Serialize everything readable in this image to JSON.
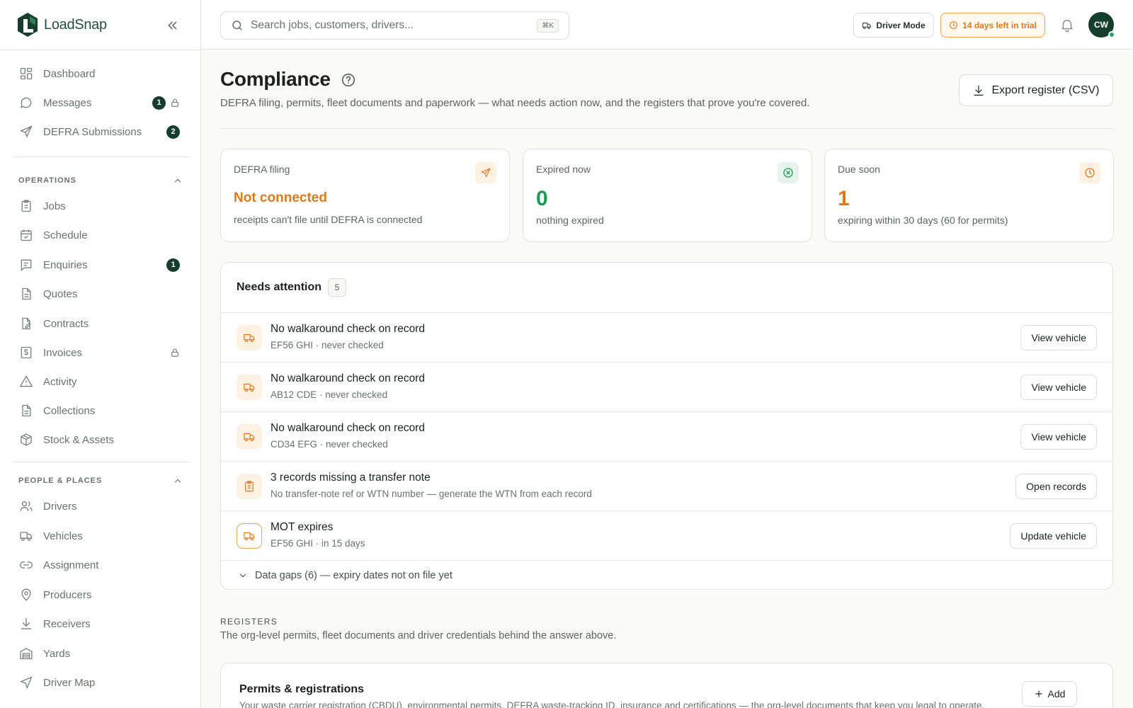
{
  "app": {
    "name": "LoadSnap",
    "brand_color": "#163e2c"
  },
  "sidebar": {
    "top_items": [
      {
        "label": "Dashboard",
        "icon": "dashboard-icon"
      },
      {
        "label": "Messages",
        "icon": "message-icon",
        "badge": "1",
        "locked": true
      },
      {
        "label": "DEFRA Submissions",
        "icon": "send-icon",
        "badge": "2"
      }
    ],
    "sections": [
      {
        "title": "OPERATIONS",
        "items": [
          {
            "label": "Jobs",
            "icon": "clipboard-icon"
          },
          {
            "label": "Schedule",
            "icon": "calendar-icon"
          },
          {
            "label": "Enquiries",
            "icon": "enquiry-icon",
            "badge": "1"
          },
          {
            "label": "Quotes",
            "icon": "document-icon"
          },
          {
            "label": "Contracts",
            "icon": "contract-icon"
          },
          {
            "label": "Invoices",
            "icon": "invoice-icon",
            "locked": true
          },
          {
            "label": "Activity",
            "icon": "warning-icon"
          },
          {
            "label": "Collections",
            "icon": "document-icon"
          },
          {
            "label": "Stock & Assets",
            "icon": "box-icon"
          }
        ]
      },
      {
        "title": "PEOPLE & PLACES",
        "items": [
          {
            "label": "Drivers",
            "icon": "users-icon"
          },
          {
            "label": "Vehicles",
            "icon": "truck-icon"
          },
          {
            "label": "Assignment",
            "icon": "link-icon"
          },
          {
            "label": "Producers",
            "icon": "map-pin-icon"
          },
          {
            "label": "Receivers",
            "icon": "download-icon"
          },
          {
            "label": "Yards",
            "icon": "warehouse-icon"
          },
          {
            "label": "Driver Map",
            "icon": "navigation-icon"
          }
        ]
      }
    ]
  },
  "topbar": {
    "search_placeholder": "Search jobs, customers, drivers...",
    "search_shortcut": "⌘K",
    "driver_mode_label": "Driver Mode",
    "trial_label": "14 days left in trial",
    "avatar_initials": "CW"
  },
  "page": {
    "title": "Compliance",
    "subtitle": "DEFRA filing, permits, fleet documents and paperwork — what needs action now, and the registers that prove you're covered.",
    "export_label": "Export register (CSV)"
  },
  "cards": [
    {
      "title": "DEFRA filing",
      "value": "Not connected",
      "sub": "receipts can't file until DEFRA is connected",
      "icon": "send-icon",
      "tone": "orange"
    },
    {
      "title": "Expired now",
      "value": "0",
      "sub": "nothing expired",
      "icon": "x-circle-icon",
      "tone": "green"
    },
    {
      "title": "Due soon",
      "value": "1",
      "sub": "expiring within 30 days (60 for permits)",
      "icon": "clock-icon",
      "tone": "orange"
    }
  ],
  "attention": {
    "title": "Needs attention",
    "count": "5",
    "rows": [
      {
        "title": "No walkaround check on record",
        "sub": "EF56 GHI · never checked",
        "action": "View vehicle",
        "icon": "truck-icon"
      },
      {
        "title": "No walkaround check on record",
        "sub": "AB12 CDE · never checked",
        "action": "View vehicle",
        "icon": "truck-icon"
      },
      {
        "title": "No walkaround check on record",
        "sub": "CD34 EFG · never checked",
        "action": "View vehicle",
        "icon": "truck-icon"
      },
      {
        "title": "3 records missing a transfer note",
        "sub": "No transfer-note ref or WTN number — generate the WTN from each record",
        "action": "Open records",
        "icon": "clipboard-icon"
      },
      {
        "title": "MOT expires",
        "sub": "EF56 GHI · in 15 days",
        "action": "Update vehicle",
        "icon": "truck-icon"
      }
    ],
    "gaps_label": "Data gaps (6) — expiry dates not on file yet"
  },
  "registers": {
    "label": "REGISTERS",
    "sub": "The org-level permits, fleet documents and driver credentials behind the answer above.",
    "permits": {
      "title": "Permits & registrations",
      "sub": "Your waste carrier registration (CBDU), environmental permits, DEFRA waste-tracking ID, insurance and certifications — the org-level documents that keep you legal to operate.",
      "add_label": "Add"
    }
  },
  "colors": {
    "orange": "#d97a1c",
    "orange_bg": "#fdf1e4",
    "green": "#1f9a54",
    "green_bg": "#e6f5ec"
  }
}
